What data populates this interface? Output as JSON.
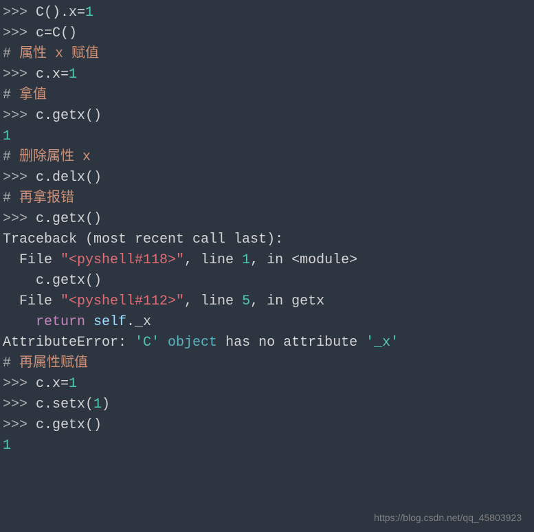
{
  "lines": {
    "l1_prompt": ">>> ",
    "l1_call": "C().x=",
    "l1_val": "1",
    "l2_prompt": ">>> ",
    "l2_code": "c=C()",
    "l3_hash": "#",
    "l3_comment": " 属性 x 赋值",
    "l4_prompt": ">>> ",
    "l4_code": "c.x=",
    "l4_val": "1",
    "l5_hash": "#",
    "l5_comment": " 拿值",
    "l6_prompt": ">>> ",
    "l6_code": "c.getx()",
    "l7_val": "1",
    "l8_hash": "#",
    "l8_comment": " 删除属性 x",
    "l9_prompt": ">>> ",
    "l9_code": "c.delx()",
    "l10_hash": "#",
    "l10_comment": " 再拿报错",
    "l11_prompt": ">>> ",
    "l11_code": "c.getx()",
    "l12_trace": "Traceback (most recent call last):",
    "l13_file": "  File ",
    "l13_str": "\"<pyshell#118>\"",
    "l13_mid": ", line ",
    "l13_num": "1",
    "l13_in": ", in ",
    "l13_mod": "<module>",
    "l14_code": "    c.getx()",
    "l15_file": "  File ",
    "l15_str": "\"<pyshell#112>\"",
    "l15_mid": ", line ",
    "l15_num": "5",
    "l15_in": ", in ",
    "l15_func": "getx",
    "l16_ret": "    return",
    "l16_self": " self",
    "l16_x": "._x",
    "l17_err": "AttributeError: ",
    "l17_c": "'C'",
    "l17_obj": " object",
    "l17_has": " has no attribute ",
    "l17_attr": "'_x'",
    "l18_hash": "#",
    "l18_comment": " 再属性赋值",
    "l19_prompt": ">>> ",
    "l19_code": "c.x=",
    "l19_val": "1",
    "l20_prompt": ">>> ",
    "l20_code": "c.setx(",
    "l20_val": "1",
    "l20_end": ")",
    "l21_prompt": ">>> ",
    "l21_code": "c.getx()",
    "l22_val": "1"
  },
  "watermark": "https://blog.csdn.net/qq_45803923"
}
